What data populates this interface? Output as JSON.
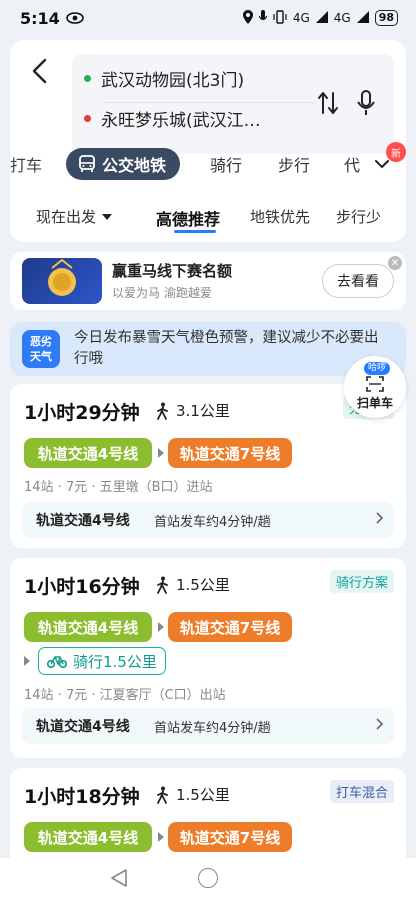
{
  "status_bar": {
    "time": "5:14",
    "signal_1": "4G",
    "signal_2": "4G",
    "battery": "98"
  },
  "route": {
    "from": "武汉动物园(北3门)",
    "to": "永旺梦乐城(武汉江…"
  },
  "mode_tabs": {
    "taxi_partial": "打车",
    "transit": "公交地铁",
    "bike": "骑行",
    "walk": "步行",
    "more_partial": "代",
    "new_badge": "新"
  },
  "pref_tabs": {
    "depart_now": "现在出发",
    "recommend": "高德推荐",
    "subway_first": "地铁优先",
    "less_walk": "步行少"
  },
  "ad": {
    "title": "赢重马线下赛名额",
    "subtitle": "以爱为马 渝跑越爱",
    "button": "去看看"
  },
  "weather": {
    "icon_text_1": "恶劣",
    "icon_text_2": "天气",
    "text": "今日发布暴雪天气橙色预警，建议减少不必要出行哦"
  },
  "scan": {
    "badge": "哈啰",
    "label": "扫单车"
  },
  "routes": [
    {
      "duration": "1小时29分钟",
      "walk": "3.1公里",
      "tag": "无堵车",
      "line_a": "轨道交通4号线",
      "line_b": "轨道交通7号线",
      "meta": "14站 · 7元 · 五里墩（B口）进站",
      "dep_line": "轨道交通4号线",
      "dep_info": "首站发车约4分钟/趟"
    },
    {
      "duration": "1小时16分钟",
      "walk": "1.5公里",
      "tag": "骑行方案",
      "line_a": "轨道交通4号线",
      "line_b": "轨道交通7号线",
      "bike": "骑行1.5公里",
      "meta": "14站 · 7元 · 江夏客厅（C口）出站",
      "dep_line": "轨道交通4号线",
      "dep_info": "首站发车约4分钟/趟"
    },
    {
      "duration": "1小时18分钟",
      "walk": "1.5公里",
      "tag": "打车混合",
      "line_a": "轨道交通4号线",
      "line_b": "轨道交通7号线"
    }
  ],
  "colors": {
    "line4": "#8cbd2e",
    "line7": "#ee7d2b",
    "accent": "#2a7cff",
    "active_tab": "#3a4a63"
  }
}
